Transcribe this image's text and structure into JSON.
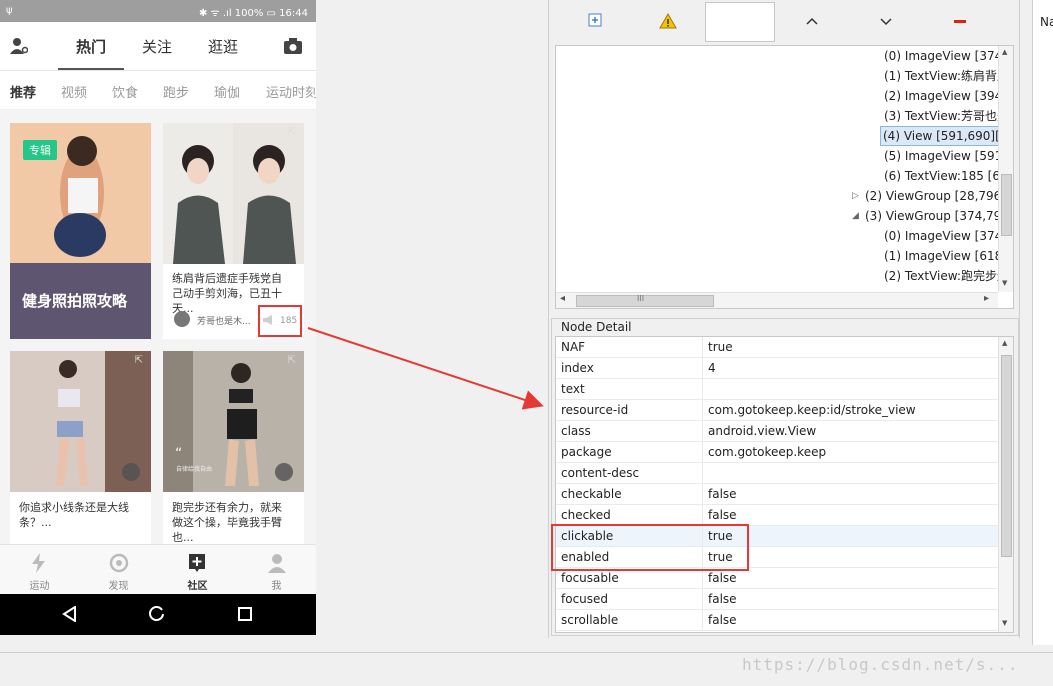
{
  "phone": {
    "status_left": "ψ",
    "status_right": "✱ ᯤ .ıl 100% ▭ 16:44",
    "tabs": [
      "热门",
      "关注",
      "逛逛"
    ],
    "categories": [
      "推荐",
      "视频",
      "饮食",
      "跑步",
      "瑜伽",
      "运动时刻"
    ],
    "cards": [
      {
        "badge": "专辑",
        "title": "健身照拍照攻略"
      },
      {
        "title": "练肩背后遗症手残党自己动手剪刘海，已丑十天...",
        "author": "芳哥也是木...",
        "likes": "185"
      },
      {
        "title": "你追求小线条还是大线条？..."
      },
      {
        "title": "跑完步还有余力，就来做这个操，毕竟我手臂也...",
        "quote_text": "自律给我自由"
      }
    ],
    "bottom_nav": [
      "运动",
      "发现",
      "社区",
      "我"
    ]
  },
  "tree": {
    "rows": [
      "(0) ImageView [374",
      "(1) TextView:练肩背后",
      "(2) ImageView [394",
      "(3) TextView:芳哥也是",
      "(4) View [591,690][6",
      "(5) ImageView [591",
      "(6) TextView:185 [62",
      "(2) ViewGroup [28,796]",
      "(3) ViewGroup [374,79",
      "(0) ImageView [374",
      "(1) ImageView [618",
      "(2) TextView:跑完步还"
    ],
    "scroll_arrow_up": "▲",
    "scroll_arrow_down": "▼",
    "scroll_left": "◂",
    "scroll_right": "▸",
    "thumb_grip": "III"
  },
  "detail": {
    "label": "Node Detail",
    "rows": [
      {
        "key": "NAF",
        "value": "true"
      },
      {
        "key": "index",
        "value": "4"
      },
      {
        "key": "text",
        "value": ""
      },
      {
        "key": "resource-id",
        "value": "com.gotokeep.keep:id/stroke_view"
      },
      {
        "key": "class",
        "value": "android.view.View"
      },
      {
        "key": "package",
        "value": "com.gotokeep.keep"
      },
      {
        "key": "content-desc",
        "value": ""
      },
      {
        "key": "checkable",
        "value": "false"
      },
      {
        "key": "checked",
        "value": "false"
      },
      {
        "key": "clickable",
        "value": "true"
      },
      {
        "key": "enabled",
        "value": "true"
      },
      {
        "key": "focusable",
        "value": "false"
      },
      {
        "key": "focused",
        "value": "false"
      },
      {
        "key": "scrollable",
        "value": "false"
      }
    ]
  },
  "far_right_label": "Na",
  "watermark": "https://blog.csdn.net/s...",
  "colors": {
    "accent_red": "#e53935",
    "topic_green": "#24c789",
    "selection_blue": "#dbe8f7"
  },
  "icons": [
    "person-settings-icon",
    "camera-icon",
    "like-megaphone-icon",
    "video-play-icon",
    "bolt-icon",
    "target-icon",
    "plus-square-icon",
    "user-icon",
    "back-triangle-icon",
    "home-circle-icon",
    "recent-square-icon",
    "expand-all-icon",
    "warning-icon",
    "chevron-up-icon",
    "chevron-down-icon",
    "collapse-minus-icon"
  ]
}
